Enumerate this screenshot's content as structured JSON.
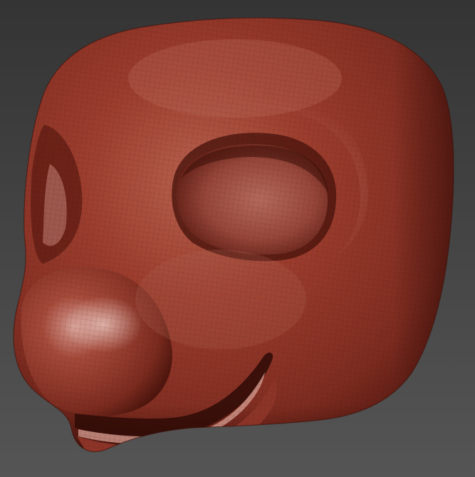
{
  "viewport": {
    "background_top": "#343434",
    "background_bottom": "#555555"
  },
  "model": {
    "subject": "sculpted-creature-head",
    "material": "red-wax",
    "colors": {
      "base": "#8a3326",
      "mid": "#9c3d2e",
      "highlight": "#c98a80",
      "specular": "#e6c2bb",
      "shadow": "#4a140d",
      "deep_shadow": "#2e0a06"
    },
    "wireframe_visible": true
  }
}
